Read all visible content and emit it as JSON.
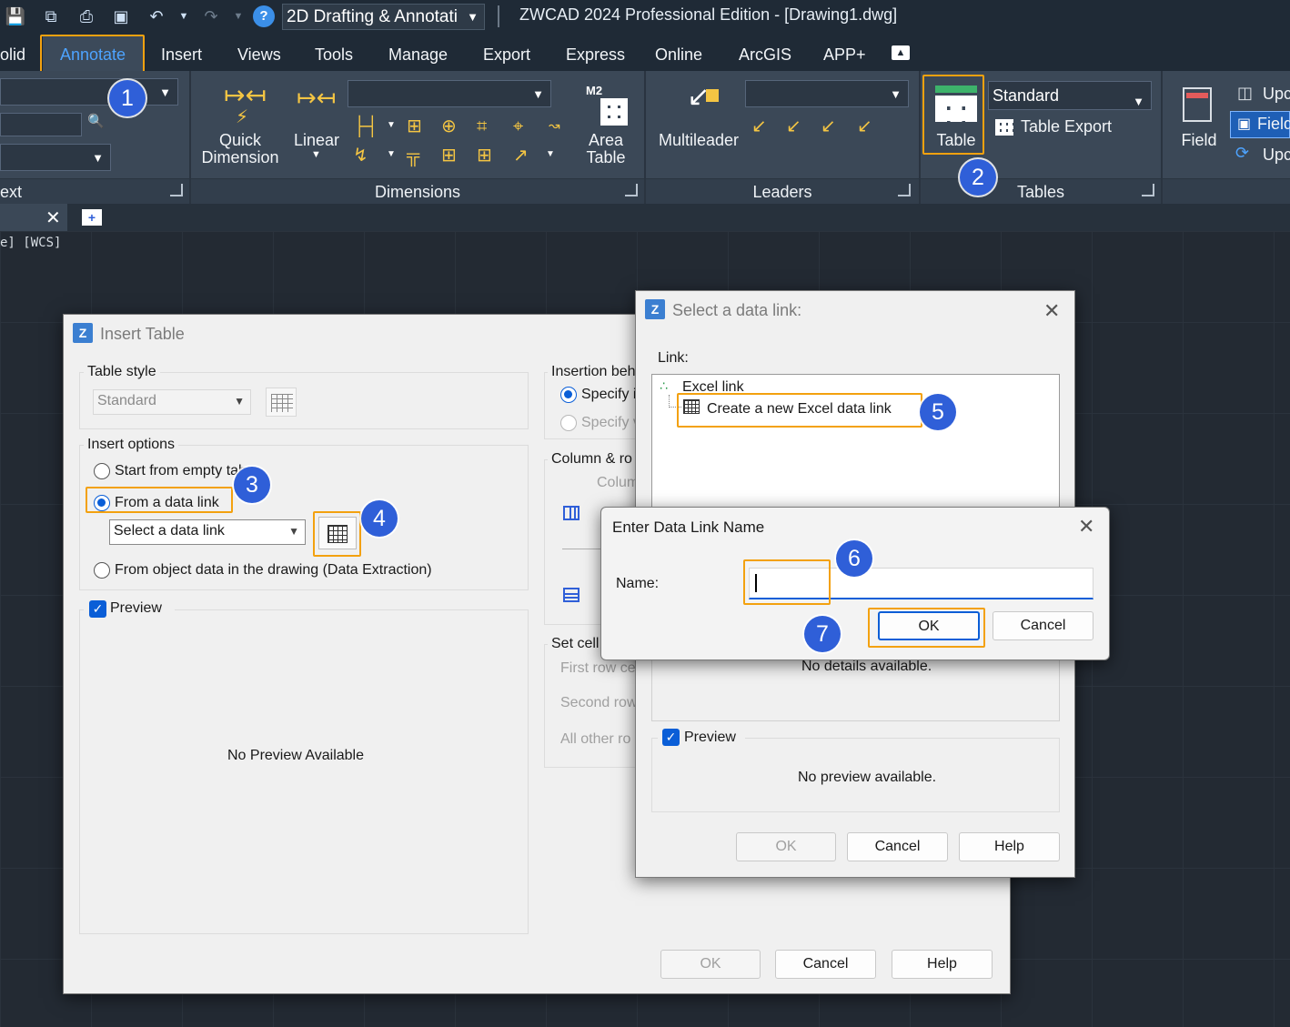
{
  "titlebar": {
    "workspace": "2D Drafting & Annotati",
    "app_title": "ZWCAD 2024 Professional Edition - [Drawing1.dwg]"
  },
  "menu_tabs": [
    "olid",
    "Annotate",
    "Insert",
    "Views",
    "Tools",
    "Manage",
    "Export",
    "Express",
    "Online",
    "ArcGIS",
    "APP+"
  ],
  "ribbon": {
    "text_panel": "ext",
    "quick_dimension": [
      "Quick",
      "Dimension"
    ],
    "linear": "Linear",
    "area_table": [
      "Area",
      "Table"
    ],
    "dimensions_panel": "Dimensions",
    "multileader": "Multileader",
    "leaders_panel": "Leaders",
    "table": "Table",
    "table_style": "Standard",
    "table_export": "Table Export",
    "tables_panel": "Tables",
    "field": "Field",
    "upd1": "Upc",
    "field2": "Field",
    "upd2": "Upc",
    "area_icon_text": "M2"
  },
  "canvas": {
    "viewport_label": "e] [WCS]"
  },
  "insert_table": {
    "title": "Insert Table",
    "table_style_group": "Table style",
    "table_style_value": "Standard",
    "insert_options_group": "Insert options",
    "opt_empty": "Start from empty tab",
    "opt_data_link": "From a data link",
    "data_link_select": "Select a data link",
    "opt_object_data": "From object data in the drawing (Data Extraction)",
    "preview_label": "Preview",
    "no_preview": "No Preview Available",
    "insertion_group": "Insertion beh",
    "specify1": "Specify i",
    "specify2": "Specify v",
    "column_group": "Column & ro",
    "column_label": "Colum",
    "set_cell_group": "Set cell",
    "first_row": "First row ce",
    "second_row": "Second row",
    "all_other": "All other ro",
    "ok": "OK",
    "cancel": "Cancel",
    "help": "Help"
  },
  "select_link": {
    "title": "Select a data link:",
    "link_label": "Link:",
    "tree_root": "Excel link",
    "tree_child": "Create a new Excel data link",
    "no_details": "No details available.",
    "preview_label": "Preview",
    "no_preview": "No preview available.",
    "ok": "OK",
    "cancel": "Cancel",
    "help": "Help"
  },
  "name_dialog": {
    "title": "Enter Data Link Name",
    "name_label": "Name:",
    "name_value": "",
    "ok": "OK",
    "cancel": "Cancel"
  },
  "badges": [
    "1",
    "2",
    "3",
    "4",
    "5",
    "6",
    "7"
  ],
  "colors": {
    "highlight": "#f3a10f",
    "badge": "#2f5fd8",
    "accent": "#0a5ed7",
    "active_tab": "#4da3ff"
  }
}
